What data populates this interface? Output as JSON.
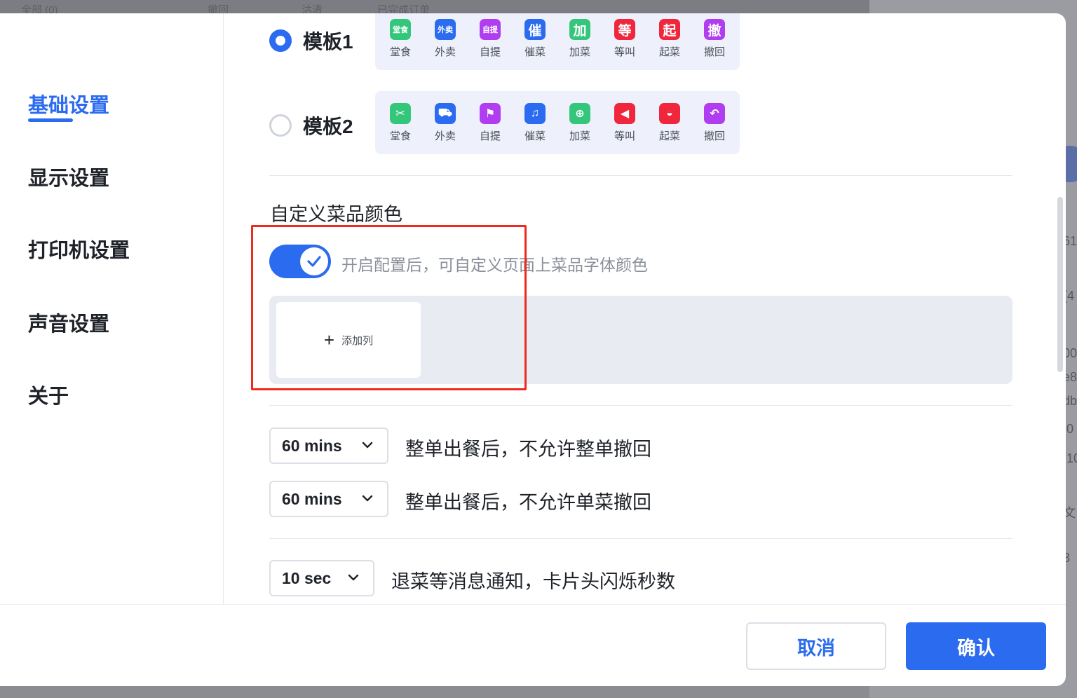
{
  "background": {
    "topbar": [
      "全部 (0)",
      "撤回",
      "沽清",
      "已完成订单"
    ],
    "fragments": [
      "61",
      "(4",
      "00",
      "e8",
      "db",
      ".0",
      ".10",
      "文",
      "3"
    ]
  },
  "sidebar": {
    "items": [
      {
        "label": "基础设置",
        "active": true
      },
      {
        "label": "显示设置",
        "active": false
      },
      {
        "label": "打印机设置",
        "active": false
      },
      {
        "label": "声音设置",
        "active": false
      },
      {
        "label": "关于",
        "active": false
      }
    ]
  },
  "templates": [
    {
      "label": "模板1",
      "selected": true,
      "icons": [
        {
          "glyph": "堂食",
          "label": "堂食",
          "color": "#34c77b",
          "icon": "dine-in-icon"
        },
        {
          "glyph": "外卖",
          "label": "外卖",
          "color": "#2b6bef",
          "icon": "takeout-icon"
        },
        {
          "glyph": "自提",
          "label": "自提",
          "color": "#b03df0",
          "icon": "pickup-icon"
        },
        {
          "glyph": "催",
          "label": "催菜",
          "color": "#2b6bef",
          "icon": "rush-icon"
        },
        {
          "glyph": "加",
          "label": "加菜",
          "color": "#34c77b",
          "icon": "add-dish-icon"
        },
        {
          "glyph": "等",
          "label": "等叫",
          "color": "#f0263c",
          "icon": "wait-call-icon"
        },
        {
          "glyph": "起",
          "label": "起菜",
          "color": "#f0263c",
          "icon": "serve-icon"
        },
        {
          "glyph": "撤",
          "label": "撤回",
          "color": "#b03df0",
          "icon": "withdraw-icon"
        }
      ]
    },
    {
      "label": "模板2",
      "selected": false,
      "icons": [
        {
          "glyph": "✂",
          "label": "堂食",
          "color": "#34c77b",
          "icon": "utensils-icon"
        },
        {
          "glyph": "⛟",
          "label": "外卖",
          "color": "#2b6bef",
          "icon": "scooter-icon"
        },
        {
          "glyph": "⚑",
          "label": "自提",
          "color": "#b03df0",
          "icon": "person-box-icon"
        },
        {
          "glyph": "♫",
          "label": "催菜",
          "color": "#2b6bef",
          "icon": "bell-icon"
        },
        {
          "glyph": "⊕",
          "label": "加菜",
          "color": "#34c77b",
          "icon": "dish-plus-icon"
        },
        {
          "glyph": "◀",
          "label": "等叫",
          "color": "#f0263c",
          "icon": "megaphone-icon"
        },
        {
          "glyph": "◒",
          "label": "起菜",
          "color": "#f0263c",
          "icon": "cloche-icon"
        },
        {
          "glyph": "↶",
          "label": "撤回",
          "color": "#b03df0",
          "icon": "undo-icon"
        }
      ]
    }
  ],
  "custom_color": {
    "title": "自定义菜品颜色",
    "toggle_on": true,
    "hint": "开启配置后，可自定义页面上菜品字体颜色",
    "add_column": "添加列"
  },
  "settings": [
    {
      "value": "60 mins",
      "desc": "整单出餐后，不允许整单撤回"
    },
    {
      "value": "60 mins",
      "desc": "整单出餐后，不允许单菜撤回"
    },
    {
      "value": "10 sec",
      "desc": "退菜等消息通知，卡片头闪烁秒数"
    }
  ],
  "footer": {
    "cancel": "取消",
    "confirm": "确认"
  },
  "colors": {
    "primary": "#2b6bef",
    "highlight": "#ee2a1f"
  }
}
